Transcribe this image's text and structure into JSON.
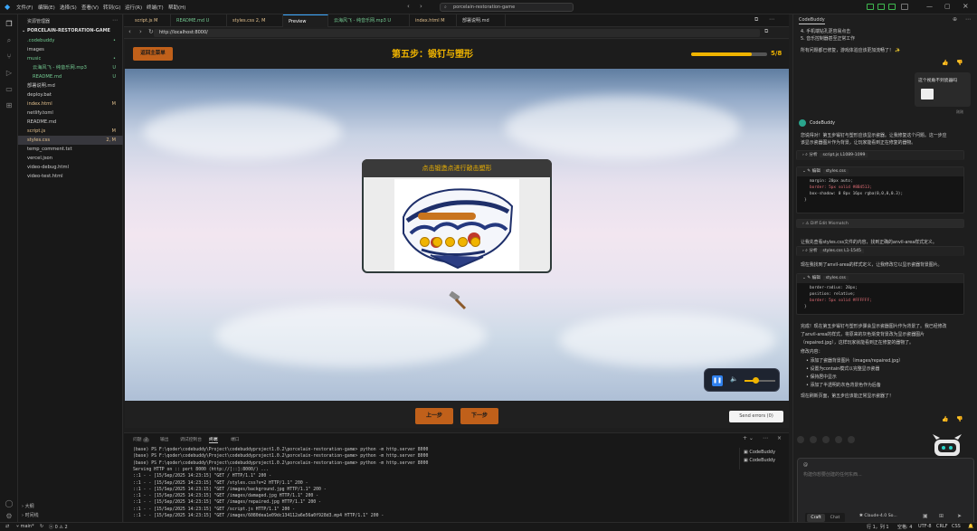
{
  "menu": [
    "文件(F)",
    "编辑(E)",
    "选择(S)",
    "查看(V)",
    "转到(G)",
    "运行(R)",
    "终端(T)",
    "帮助(H)"
  ],
  "command_center": "porcelain-restoration-game",
  "explorer": {
    "header": "资源管理器",
    "project": "PORCELAIN-RESTORATION-GAME",
    "items": [
      {
        "name": ".codebuddy",
        "status": "•",
        "color": "#73c991",
        "indent": 1
      },
      {
        "name": "images",
        "status": "",
        "color": "#cccccc",
        "indent": 1
      },
      {
        "name": "music",
        "status": "•",
        "color": "#73c991",
        "indent": 1
      },
      {
        "name": "云海风飞 - 纯音乐网.mp3",
        "status": "U",
        "color": "#73c991",
        "indent": 2
      },
      {
        "name": "README.md",
        "status": "U",
        "color": "#73c991",
        "indent": 2
      },
      {
        "name": "部署说明.md",
        "status": "",
        "color": "#cccccc",
        "indent": 1
      },
      {
        "name": "deploy.bat",
        "status": "",
        "color": "#cccccc",
        "indent": 1
      },
      {
        "name": "index.html",
        "status": "M",
        "color": "#e2c08d",
        "indent": 1
      },
      {
        "name": "netlify.toml",
        "status": "",
        "color": "#cccccc",
        "indent": 1
      },
      {
        "name": "README.md",
        "status": "",
        "color": "#cccccc",
        "indent": 1
      },
      {
        "name": "script.js",
        "status": "M",
        "color": "#e2c08d",
        "indent": 1
      },
      {
        "name": "styles.css",
        "status": "2, M",
        "color": "#e2c08d",
        "indent": 1
      },
      {
        "name": "temp_comment.txt",
        "status": "",
        "color": "#cccccc",
        "indent": 1
      },
      {
        "name": "vercel.json",
        "status": "",
        "color": "#cccccc",
        "indent": 1
      },
      {
        "name": "video-debug.html",
        "status": "",
        "color": "#cccccc",
        "indent": 1
      },
      {
        "name": "video-test.html",
        "status": "",
        "color": "#cccccc",
        "indent": 1
      }
    ],
    "outline": "大纲",
    "timeline": "时间线"
  },
  "tabs": [
    {
      "label": "script.js  M",
      "color": "#e2c08d"
    },
    {
      "label": "README.md  U",
      "color": "#73c991"
    },
    {
      "label": "styles.css  2, M",
      "color": "#e2c08d"
    },
    {
      "label": "Preview",
      "color": "#ffffff"
    },
    {
      "label": "云海风飞 - 纯音乐网.mp3  U",
      "color": "#73c991"
    },
    {
      "label": "index.html  M",
      "color": "#e2c08d"
    },
    {
      "label": "部署说明.md",
      "color": "#cccccc"
    }
  ],
  "url": "http://localhost:8000/",
  "game": {
    "back_button": "返回主菜单",
    "step_title": "第五步：锻钉与塑形",
    "progress": 0.8,
    "progress_text": "5/8",
    "card_title": "点击锻造点进行敲击塑形",
    "forge_points": 5,
    "prev_button": "上一步",
    "next_button": "下一步",
    "send_errors": "Send errors (0)",
    "volume": 0.35
  },
  "panel": {
    "tabs": [
      "问题",
      "输出",
      "调试控制台",
      "终端",
      "端口"
    ],
    "problems_count": "2",
    "terminal_lines": [
      "(base) PS F:\\qoder\\codebuddy\\Project\\codebuddyproject1.0.2\\porcelain-restoration-game> python -m http.server 8000",
      "(base) PS F:\\qoder\\codebuddy\\Project\\codebuddyproject1.0.2\\porcelain-restoration-game> python -m http.server 8000",
      "(base) PS F:\\qoder\\codebuddy\\Project\\codebuddyproject1.0.2\\porcelain-restoration-game> python -m http.server 8000",
      "Serving HTTP on :: port 8000 (http://[::]:8000/) ...",
      "::1 - - [15/Sep/2025 14:23:15] \"GET / HTTP/1.1\" 200 -",
      "::1 - - [15/Sep/2025 14:23:15] \"GET /styles.css?v=2 HTTP/1.1\" 200 -",
      "::1 - - [15/Sep/2025 14:23:15] \"GET /images/background.jpg HTTP/1.1\" 200 -",
      "::1 - - [15/Sep/2025 14:23:15] \"GET /images/damaged.jpg HTTP/1.1\" 200 -",
      "::1 - - [15/Sep/2025 14:23:15] \"GET /images/repaired.jpg HTTP/1.1\" 200 -",
      "::1 - - [15/Sep/2025 14:23:15] \"GET /script.js HTTP/1.1\" 200 -",
      "::1 - - [15/Sep/2025 14:23:15] \"GET /images/6080dea1e09dc134112a6e56a0f928d3.mp4 HTTP/1.1\" 200 -"
    ],
    "terminal_list": [
      "CodeBuddy",
      "CodeBuddy"
    ]
  },
  "assistant": {
    "title": "CodeBuddy",
    "lines_top": [
      "4. 手机端钻孔更容易点击",
      "5. 音乐控制器甚至正常工作"
    ],
    "line_feedback": "所有问题都已修复，游戏体验应该更加流畅了！ ✨",
    "user_msg": "这个视角不到瓷器吗",
    "user_time": "刚刚",
    "bot_name": "CodeBuddy",
    "intro": [
      "您说得对！第五步锻钉与塑形应该显示瓷器。让我修复这个问题。这一步应",
      "该显示瓷器图片作为背景，让玩家能看到正在修复的器物。"
    ],
    "box1_label": "分析",
    "box1_file": "script.js  L1089-1099",
    "box2_label": "编辑",
    "box2_file": "styles.css",
    "box2_code": [
      "margin: 20px auto;",
      "border: 5px solid #8B4513;",
      "box-shadow: 0 8px 16px rgba(0,0,0,0.3);",
      "}"
    ],
    "mismatch": "Diff Edit Mismatch",
    "retry_text": "让我先查看styles.css文件的内容，找到正确的anvil-area样式定义。",
    "box3_label": "分析",
    "box3_file": "styles.css  L1-1545",
    "found_text": "现在我找到了anvil-area的样式定义，让我修改它以显示瓷器背景图片。",
    "box4_label": "编辑",
    "box4_file": "styles.css",
    "box4_code": [
      "border-radius: 20px;",
      "position: relative;",
      "border: 5px solid #FFFFFF;",
      "}"
    ],
    "done_text": [
      "完成！现在第五步锻钉与塑形步骤会显示瓷器图片作为背景了。我已经修改",
      "了anvil-area的样式，将原来的灰色渐变背景改为显示瓷器图片",
      "（repaired.jpg），这样玩家就能看到正在修复的器物了。"
    ],
    "changes_head": "修改内容：",
    "changes": [
      "添加了瓷器背景图片（images/repaired.jpg）",
      "设置为contain模式以完整显示瓷器",
      "保持居中显示",
      "添加了半透明的灰色背景色作为后备"
    ],
    "final": "现在刷新页面，第五步应该能正常显示瓷器了！",
    "input_placeholder": "构建你想要创建的任何东西...",
    "mode_craft": "Craft",
    "mode_chat": "Chat",
    "model": "Claude-4.0 So..."
  },
  "statusbar": {
    "branch": "main*",
    "errors": "0",
    "warnings": "2",
    "position": "行 1，列 1",
    "spaces": "空格: 4",
    "encoding": "UTF-8",
    "eol": "CRLF",
    "lang": "CSS"
  },
  "colors": {
    "accent": "#f0b400",
    "button": "#c0601a",
    "modified": "#e2c08d",
    "untracked": "#73c991"
  }
}
